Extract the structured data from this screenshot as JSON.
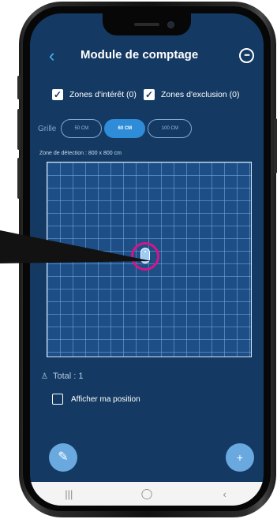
{
  "colors": {
    "screen_bg": "#143a63",
    "accent": "#2f8cd8",
    "target_ring": "#d5148a",
    "grid_line": "#78aae1"
  },
  "header": {
    "back_icon": "‹",
    "title": "Module de comptage",
    "more_icon": "•••"
  },
  "zones": {
    "interest": {
      "label": "Zones d'intérêt (0)",
      "checked": true
    },
    "exclusion": {
      "label": "Zones d'exclusion (0)",
      "checked": true
    }
  },
  "grid": {
    "label": "Grille",
    "options": [
      "50 CM",
      "60 CM",
      "100 CM"
    ],
    "selected": "60 CM"
  },
  "detection": {
    "label": "Zone de détection : 800 x 800 cm"
  },
  "summary": {
    "total": "Total : 1"
  },
  "position": {
    "label": "Afficher ma position",
    "checked": false
  },
  "fab": {
    "edit_icon": "✎",
    "add_icon": "+"
  },
  "navbar": {
    "recents": "|||",
    "home": "◯",
    "back": "‹"
  }
}
